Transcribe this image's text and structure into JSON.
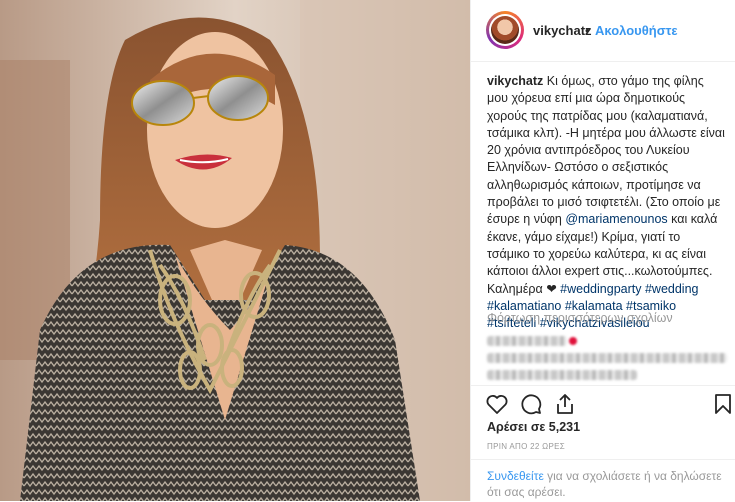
{
  "header": {
    "username": "vikychatz",
    "separator": "•",
    "follow_label": "Ακολουθήστε"
  },
  "caption": {
    "username": "vikychatz",
    "text_1": " Κι όμως, στο γάμο της φίλης μου χόρευα επί μια ώρα δημοτικούς χορούς της πατρίδας μου (καλαματιανά, τσάμικα κλπ). -Η μητέρα μου άλλωστε είναι 20 χρόνια αντιπρόεδρος του Λυκείου Ελληνίδων- Ωστόσο ο σεξιστικός αλληθωρισμός κάποιων, προτίμησε να προβάλει το μισό τσιφτετέλι. (Στο οποίο με έσυρε η νύφη ",
    "mention": "@mariamenounos",
    "text_2": " και καλά έκανε, γάμο είχαμε!) Κρίμα, γιατί το τσάμικο το χορεύω καλύτερα, κι ας είναι κάποιοι άλλοι expert στις...κωλοτούμπες. Καλημέρα ",
    "heart": "❤",
    "hashtags": [
      "#weddingparty",
      "#wedding",
      "#kalamatiano",
      "#kalamata",
      "#tsamiko",
      "#tsifteteli",
      "#vikychatzivasileiou"
    ]
  },
  "comments": {
    "load_more_label": "Φόρτωση περισσότερων σχολίων"
  },
  "actions": {
    "like_icon": "heart-icon",
    "comment_icon": "comment-icon",
    "share_icon": "share-icon",
    "save_icon": "bookmark-icon"
  },
  "likes_label": "Αρέσει σε 5,231",
  "timestamp": "ΠΡΙΝ ΑΠΟ 22 ΩΡΕΣ",
  "login_prompt": {
    "link": "Συνδεθείτε",
    "text": " για να σχολιάσετε ή να δηλώσετε ότι σας αρέσει."
  },
  "colors": {
    "link_blue": "#3897f0",
    "mention_blue": "#003569",
    "muted": "#999999",
    "text": "#262626"
  }
}
